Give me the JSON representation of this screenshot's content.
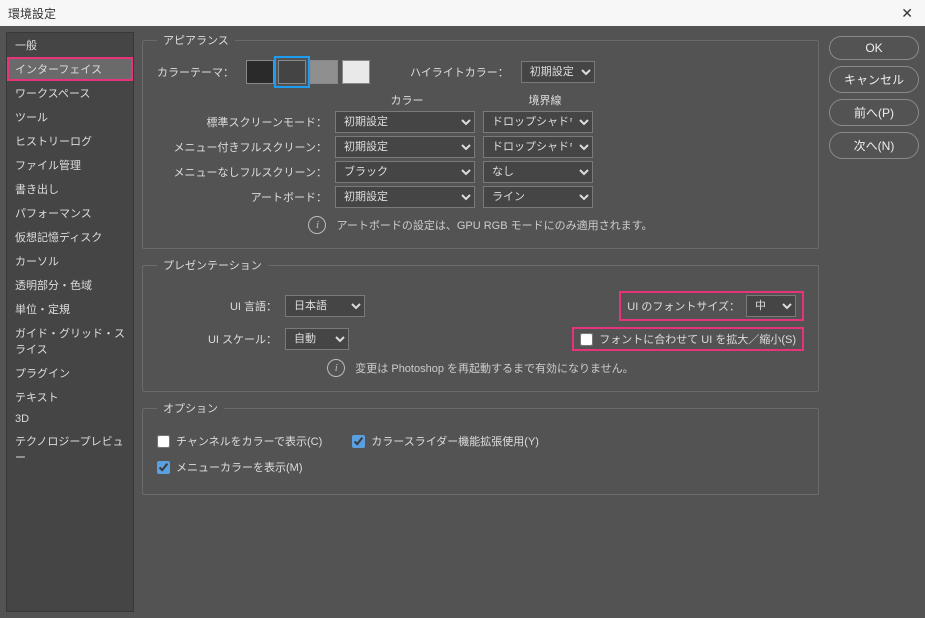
{
  "window": {
    "title": "環境設定"
  },
  "buttons": {
    "ok": "OK",
    "cancel": "キャンセル",
    "prev": "前へ(P)",
    "next": "次へ(N)"
  },
  "sidebar": {
    "items": [
      {
        "label": "一般"
      },
      {
        "label": "インターフェイス",
        "highlighted": true,
        "selected": true
      },
      {
        "label": "ワークスペース"
      },
      {
        "label": "ツール"
      },
      {
        "label": "ヒストリーログ"
      },
      {
        "label": "ファイル管理"
      },
      {
        "label": "書き出し"
      },
      {
        "label": "パフォーマンス"
      },
      {
        "label": "仮想記憶ディスク"
      },
      {
        "label": "カーソル"
      },
      {
        "label": "透明部分・色域"
      },
      {
        "label": "単位・定規"
      },
      {
        "label": "ガイド・グリッド・スライス"
      },
      {
        "label": "プラグイン"
      },
      {
        "label": "テキスト"
      },
      {
        "label": "3D"
      },
      {
        "label": "テクノロジープレビュー"
      }
    ]
  },
  "appearance": {
    "legend": "アピアランス",
    "colorThemeLabel": "カラーテーマ：",
    "swatches": [
      "#2a2a2a",
      "#444444",
      "#8f8f8f",
      "#e9e9e9"
    ],
    "selectedSwatch": 1,
    "highlightLabel": "ハイライトカラー：",
    "highlightValue": "初期設定",
    "colHeaders": {
      "color": "カラー",
      "border": "境界線"
    },
    "rows": [
      {
        "label": "標準スクリーンモード：",
        "color": "初期設定",
        "border": "ドロップシャドウ"
      },
      {
        "label": "メニュー付きフルスクリーン：",
        "color": "初期設定",
        "border": "ドロップシャドウ"
      },
      {
        "label": "メニューなしフルスクリーン：",
        "color": "ブラック",
        "border": "なし"
      },
      {
        "label": "アートボード：",
        "color": "初期設定",
        "border": "ライン"
      }
    ],
    "info": "アートボードの設定は、GPU RGB モードにのみ適用されます。"
  },
  "presentation": {
    "legend": "プレゼンテーション",
    "langLabel": "UI 言語：",
    "langValue": "日本語",
    "fontSizeLabel": "UI のフォントサイズ：",
    "fontSizeValue": "中",
    "scaleLabel": "UI スケール：",
    "scaleValue": "自動",
    "fitLabel": "フォントに合わせて UI を拡大／縮小(S)",
    "fitChecked": false,
    "info": "変更は Photoshop を再起動するまで有効になりません。"
  },
  "options": {
    "legend": "オプション",
    "items": [
      {
        "label": "チャンネルをカラーで表示(C)",
        "checked": false
      },
      {
        "label": "カラースライダー機能拡張使用(Y)",
        "checked": true
      },
      {
        "label": "メニューカラーを表示(M)",
        "checked": true
      }
    ]
  }
}
